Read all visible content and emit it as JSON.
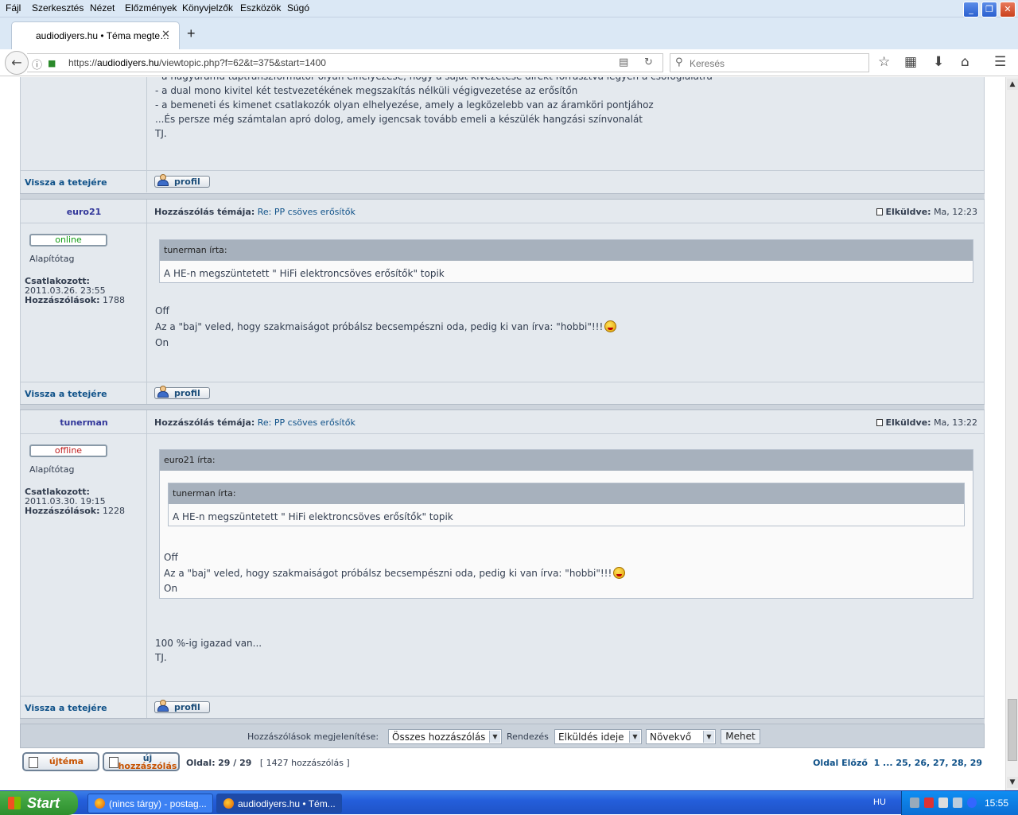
{
  "menu": [
    "Fájl",
    "Szerkesztés",
    "Nézet",
    "Előzmények",
    "Könyvjelzők",
    "Eszközök",
    "Súgó"
  ],
  "window_controls": [
    "_",
    "❐",
    "✕"
  ],
  "tab": {
    "title": "audiodiyers.hu • Téma megte…",
    "close": "✕",
    "new_tab": "+"
  },
  "nav": {
    "url_prefix": "https://",
    "url_host": "audiodiyers.hu",
    "url_path": "/viewtopic.php?f=62&t=375&start=1400",
    "search_placeholder": "Keresés"
  },
  "post0": {
    "lines": [
      "- a nagyáramú táptranszformátor olyan elhelyezése, hogy a saját kivezetése direkt forrasztva legyen a csőfoglalatra",
      "- a dual mono kivitel két testvezetékének megszakítás nélküli végigvezetése az erősítőn",
      "- a bemeneti és kimenet csatlakozók olyan elhelyezése, amely a legközelebb van az áramköri pontjához",
      "...És persze még számtalan apró dolog, amely igencsak tovább emeli a készülék hangzási színvonalát",
      "TJ."
    ]
  },
  "labels": {
    "back_to_top": "Vissza a tetejére",
    "profile": "profil",
    "subject_label": "Hozzászólás témája:",
    "sent_label": "Elküldve:",
    "joined": "Csatlakozott:",
    "posts": "Hozzászólások:"
  },
  "post1": {
    "username": "euro21",
    "status": "online",
    "rank": "Alapítótag",
    "joined": "2011.03.26. 23:55",
    "posts": "1788",
    "subject": "Re: PP csöves erősítők",
    "sent": "Ma, 12:23",
    "quote_header": "tunerman írta:",
    "quote_text": "A HE-n megszüntetett \" HiFi elektroncsöves erősítők\" topik",
    "lines": [
      "Off",
      "Az a \"baj\" veled, hogy szakmaiságot próbálsz becsempészni oda, pedig ki van írva: \"hobbi\"!!!",
      "On"
    ]
  },
  "post2": {
    "username": "tunerman",
    "status": "offline",
    "rank": "Alapítótag",
    "joined": "2011.03.30. 19:15",
    "posts": "1228",
    "subject": "Re: PP csöves erősítők",
    "sent": "Ma, 13:22",
    "outer_quote_header": "euro21 írta:",
    "inner_quote_header": "tunerman írta:",
    "inner_quote_text": "A HE-n megszüntetett \" HiFi elektroncsöves erősítők\" topik",
    "quote_lines": [
      "Off",
      "Az a \"baj\" veled, hogy szakmaiságot próbálsz becsempészni oda, pedig ki van írva: \"hobbi\"!!!",
      "On"
    ],
    "lines": [
      "100 %-ig igazad van...",
      "TJ."
    ]
  },
  "sort": {
    "display_label": "Hozzászólások megjelenítése:",
    "display_value": "Összes hozzászólás",
    "sort_label": "Rendezés",
    "sort_value": "Elküldés ideje",
    "order_value": "Növekvő",
    "go": "Mehet"
  },
  "buttons": {
    "new_topic": "újtéma",
    "reply_1": "új",
    "reply_2": "hozzászólás"
  },
  "pagination": {
    "page_label": "Oldal:",
    "page_value": "29 / 29",
    "count": "[ 1427 hozzászólás ]",
    "nav_text": "Oldal Előző",
    "pages": "1 ... 25, 26, 27, 28, 29"
  },
  "taskbar": {
    "start": "Start",
    "tasks": [
      "(nincs tárgy) - postag...",
      "audiodiyers.hu • Tém..."
    ],
    "lang": "HU",
    "clock": "15:55"
  },
  "colors": {
    "link": "#105289",
    "username": "#32379a",
    "online": "#149d14",
    "offline": "#c02020",
    "accent": "#c75200"
  }
}
